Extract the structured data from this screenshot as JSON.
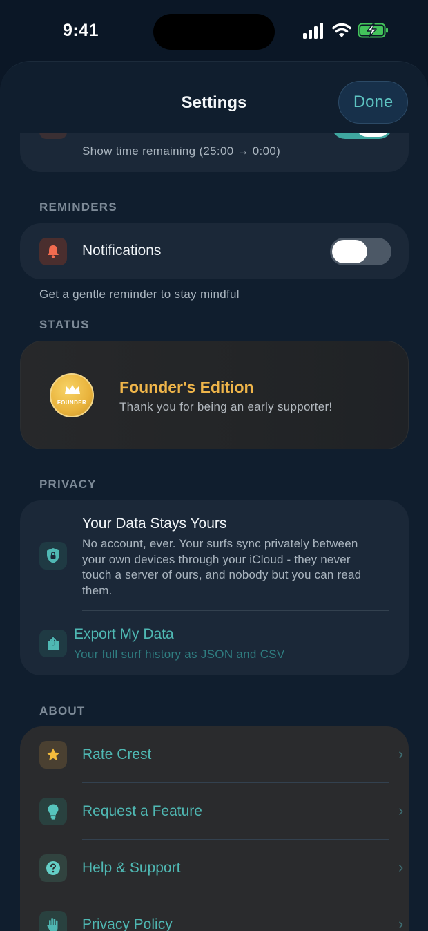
{
  "status_bar": {
    "time": "9:41"
  },
  "header": {
    "title": "Settings",
    "done_label": "Done"
  },
  "timer": {
    "subtitle": "Show time remaining (25:00 → 0:00)"
  },
  "reminders": {
    "section_label": "REMINDERS",
    "notifications_label": "Notifications",
    "notifications_on": false,
    "footer": "Get a gentle reminder to stay mindful"
  },
  "status": {
    "section_label": "STATUS",
    "badge_text": "FOUNDER",
    "title": "Founder's Edition",
    "subtitle": "Thank you for being an early supporter!"
  },
  "privacy": {
    "section_label": "PRIVACY",
    "data_title": "Your Data Stays Yours",
    "data_lines": [
      "No account, ever. Your surfs sync privately between",
      "your own devices through your iCloud - they never",
      "touch a server of ours, and nobody but you can read",
      "them."
    ],
    "export_title": "Export My Data",
    "export_subtitle": "Your full surf history as JSON and CSV"
  },
  "about": {
    "section_label": "ABOUT",
    "items": [
      {
        "label": "Rate Crest",
        "icon": "star-icon"
      },
      {
        "label": "Request a Feature",
        "icon": "lightbulb-icon"
      },
      {
        "label": "Help & Support",
        "icon": "question-icon"
      },
      {
        "label": "Privacy Policy",
        "icon": "hand-icon"
      }
    ]
  },
  "colors": {
    "accent": "#4fb8b3",
    "gold": "#e8b54a",
    "background": "#0b1726"
  }
}
